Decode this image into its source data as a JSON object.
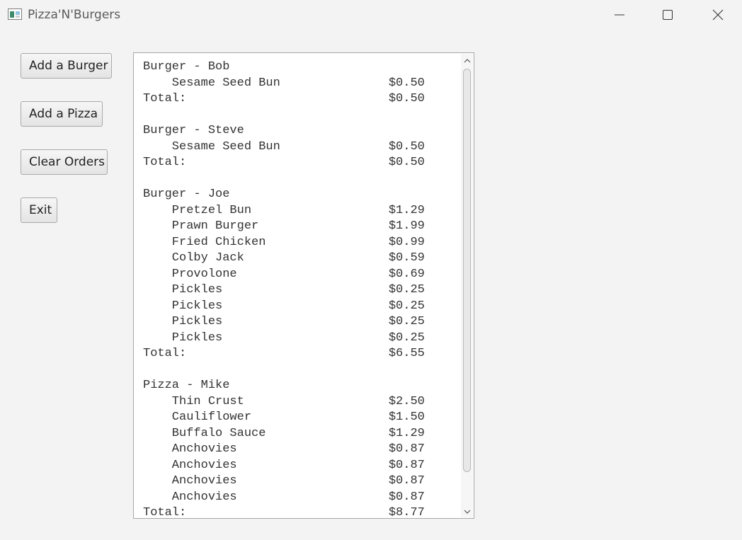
{
  "window": {
    "title": "Pizza'N'Burgers",
    "icons": {
      "app": "app-window-icon",
      "minimize": "minimize-icon",
      "maximize": "maximize-icon",
      "close": "close-icon"
    }
  },
  "buttons": {
    "add_burger": "Add a Burger",
    "add_pizza": "Add a Pizza",
    "clear_orders": "Clear Orders",
    "exit": "Exit"
  },
  "orders_text": "Burger - Bob\n    Sesame Seed Bun               $0.50\nTotal:                            $0.50\n\nBurger - Steve\n    Sesame Seed Bun               $0.50\nTotal:                            $0.50\n\nBurger - Joe\n    Pretzel Bun                   $1.29\n    Prawn Burger                  $1.99\n    Fried Chicken                 $0.99\n    Colby Jack                    $0.59\n    Provolone                     $0.69\n    Pickles                       $0.25\n    Pickles                       $0.25\n    Pickles                       $0.25\n    Pickles                       $0.25\nTotal:                            $6.55\n\nPizza - Mike\n    Thin Crust                    $2.50\n    Cauliflower                   $1.50\n    Buffalo Sauce                 $1.29\n    Anchovies                     $0.87\n    Anchovies                     $0.87\n    Anchovies                     $0.87\n    Anchovies                     $0.87\nTotal:                            $8.77",
  "scrollbar": {
    "up_icon": "scroll-up-arrow-icon",
    "down_icon": "scroll-down-arrow-icon"
  },
  "colors": {
    "window_bg": "#f3f3f3",
    "text_area_bg": "#ffffff",
    "text": "#333333"
  }
}
